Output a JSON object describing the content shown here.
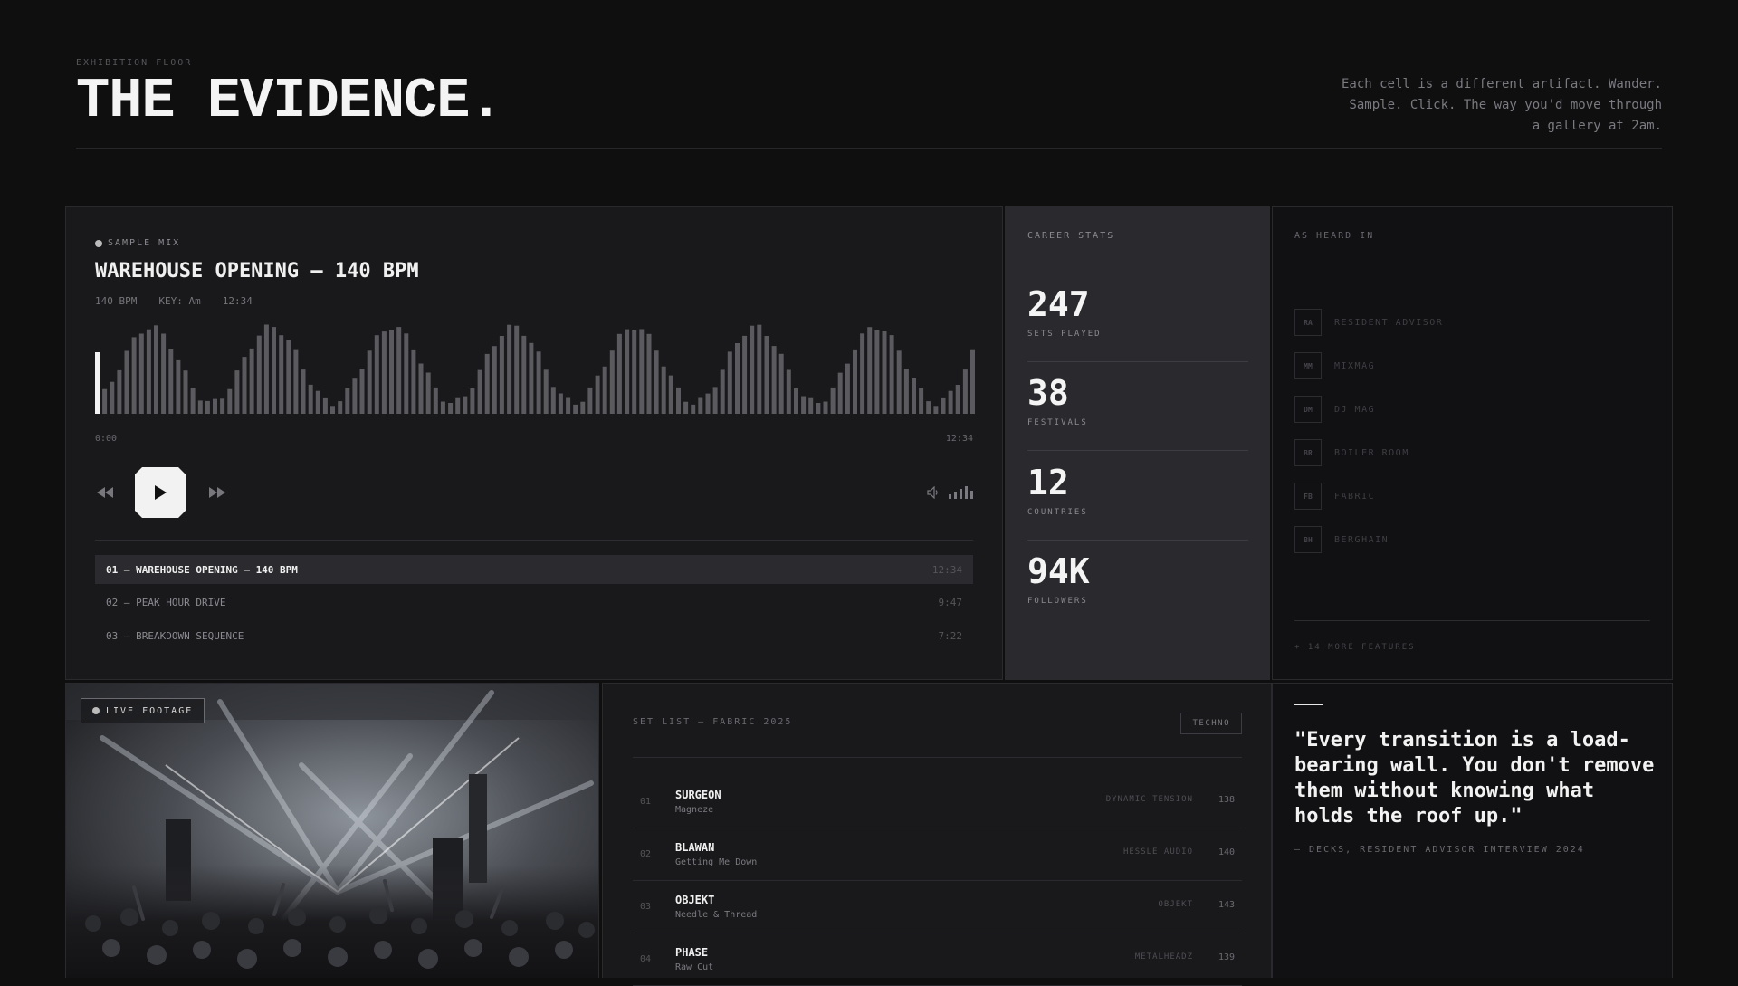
{
  "header": {
    "eyebrow": "EXHIBITION FLOOR",
    "title": "THE EVIDENCE.",
    "intro": "Each cell is a different artifact. Wander. Sample. Click. The way you'd move through a gallery at 2am."
  },
  "player": {
    "eyebrow": "SAMPLE MIX",
    "title": "WAREHOUSE OPENING — 140 BPM",
    "bpm": "140 BPM",
    "key": "KEY: Am",
    "duration": "12:34",
    "time_start": "0:00",
    "time_end": "12:34",
    "progress": 0.0,
    "tracks": [
      {
        "label": "01 — WAREHOUSE OPENING — 140 BPM",
        "duration": "12:34",
        "active": true
      },
      {
        "label": "02 — PEAK HOUR DRIVE",
        "duration": "9:47",
        "active": false
      },
      {
        "label": "03 — BREAKDOWN SEQUENCE",
        "duration": "7:22",
        "active": false
      }
    ],
    "icons": [
      "rewind-icon",
      "play-icon",
      "fast-forward-icon",
      "volume-icon"
    ]
  },
  "stats": {
    "eyebrow": "CAREER STATS",
    "items": [
      {
        "value": "247",
        "label": "SETS PLAYED"
      },
      {
        "value": "38",
        "label": "FESTIVALS"
      },
      {
        "value": "12",
        "label": "COUNTRIES"
      },
      {
        "value": "94K",
        "label": "FOLLOWERS"
      }
    ]
  },
  "heard": {
    "eyebrow": "AS HEARD IN",
    "items": [
      {
        "badge": "RA",
        "name": "RESIDENT ADVISOR"
      },
      {
        "badge": "MM",
        "name": "MIXMAG"
      },
      {
        "badge": "DM",
        "name": "DJ MAG"
      },
      {
        "badge": "BR",
        "name": "BOILER ROOM"
      },
      {
        "badge": "FB",
        "name": "FABRIC"
      },
      {
        "badge": "BH",
        "name": "BERGHAIN"
      }
    ],
    "more": "+ 14 MORE FEATURES"
  },
  "live": {
    "badge": "LIVE FOOTAGE"
  },
  "setlist": {
    "heading": "SET LIST — FABRIC 2025",
    "tag": "TECHNO",
    "rows": [
      {
        "no": "01",
        "artist": "SURGEON",
        "track": "Magneze",
        "label": "DYNAMIC TENSION",
        "bpm": "138"
      },
      {
        "no": "02",
        "artist": "BLAWAN",
        "track": "Getting Me Down",
        "label": "HESSLE AUDIO",
        "bpm": "140"
      },
      {
        "no": "03",
        "artist": "OBJEKT",
        "track": "Needle & Thread",
        "label": "OBJEKT",
        "bpm": "143"
      },
      {
        "no": "04",
        "artist": "PHASE",
        "track": "Raw Cut",
        "label": "METALHEADZ",
        "bpm": "139"
      }
    ]
  },
  "quote": {
    "text": "\"Every transition is a load-bearing wall. You don't remove them without knowing what holds the roof up.\"",
    "cite": "— DECKS, RESIDENT ADVISOR INTERVIEW 2024"
  },
  "colors": {
    "background": "#0f0f10",
    "panel": "#19191b",
    "stats_panel": "#2a2a2e",
    "accent": "#f2f2f2",
    "wave": "#5a5a5f"
  }
}
